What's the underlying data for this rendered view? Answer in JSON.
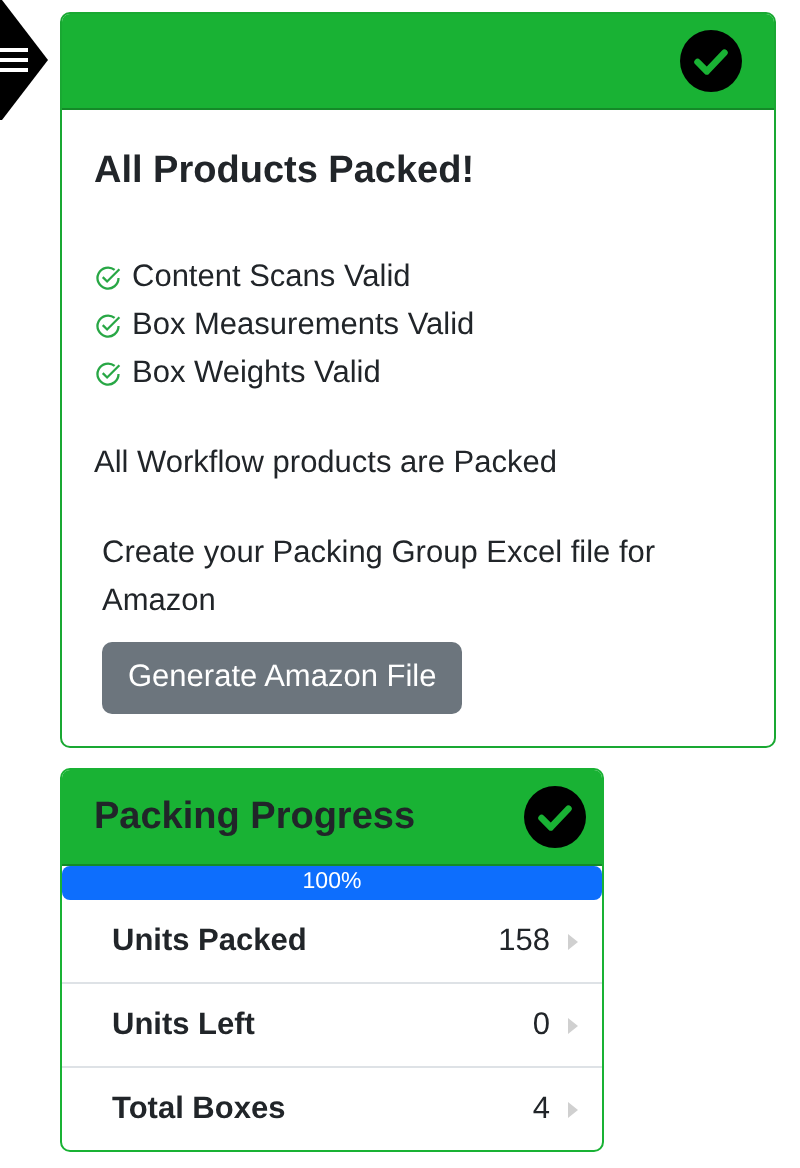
{
  "summary_card": {
    "complete": true,
    "title": "All Products Packed!",
    "checks": [
      {
        "label": "Content Scans Valid",
        "valid": true
      },
      {
        "label": "Box Measurements Valid",
        "valid": true
      },
      {
        "label": "Box Weights Valid",
        "valid": true
      }
    ],
    "status_text": "All Workflow products are Packed",
    "export_prompt": "Create your Packing Group Excel file for Amazon",
    "export_button": "Generate Amazon File"
  },
  "progress_card": {
    "title": "Packing Progress",
    "complete": true,
    "level": 1,
    "reading": "100%",
    "rows": [
      {
        "label": "Units Packed",
        "value": "158"
      },
      {
        "label": "Units Left",
        "value": "0"
      },
      {
        "label": "Total Boxes",
        "value": "4"
      }
    ]
  }
}
